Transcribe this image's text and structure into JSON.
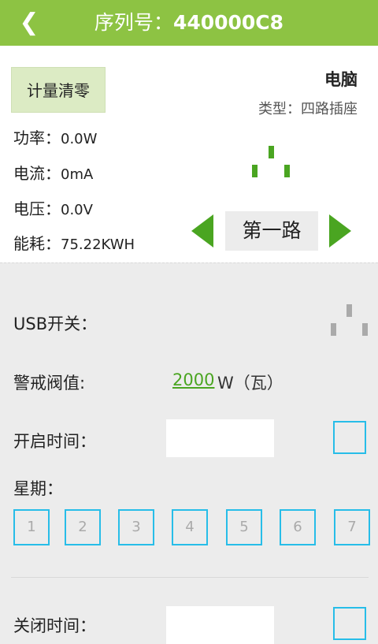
{
  "header": {
    "back_icon": "chevron-left-icon",
    "serial_label": "序列号：",
    "serial_value": "440000C8"
  },
  "info": {
    "reset_label": "计量清零",
    "device_name": "电脑",
    "device_type": "类型：四路插座",
    "power_label": "功率：",
    "power_value": "0.0W",
    "current_label": "电流：",
    "current_value": "0mA",
    "voltage_label": "电压：",
    "voltage_value": "0.0V",
    "energy_label": "能耗：",
    "energy_value": "75.22KWH",
    "channel_label": "第一路",
    "socket_icon_active_color": "#4aa521"
  },
  "settings": {
    "usb_label": "USB开关：",
    "usb_icon_color": "#aaaaaa",
    "threshold_label": "警戒阀值:",
    "threshold_value": "2000",
    "threshold_unit": "W（瓦）",
    "on_time_label": "开启时间：",
    "on_time_value": "",
    "weekday_label": "星期：",
    "days": [
      "1",
      "2",
      "3",
      "4",
      "5",
      "6",
      "7"
    ],
    "off_time_label": "关闭时间：",
    "off_time_value": ""
  },
  "colors": {
    "header_bg": "#8dc343",
    "accent_green": "#4aa521",
    "checkbox_border": "#27bde8"
  }
}
